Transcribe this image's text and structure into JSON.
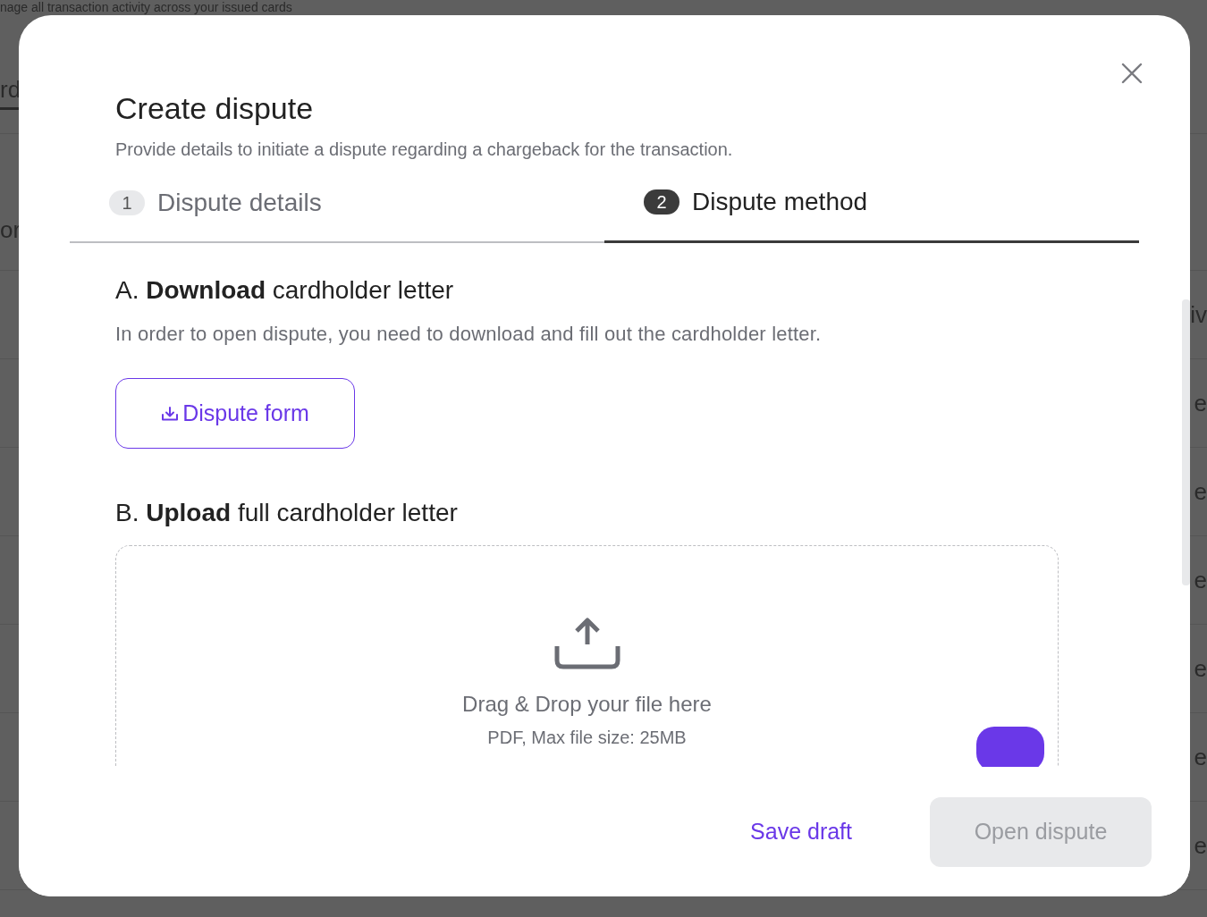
{
  "background_page": {
    "subtitle": "nage all transaction activity across your issued cards",
    "left_fragments": [
      "rd",
      "or"
    ],
    "right_fragments": [
      "iv",
      "e",
      "e",
      "e",
      "e",
      "e",
      "e"
    ]
  },
  "dialog": {
    "title": "Create dispute",
    "subtitle": "Provide details to initiate a dispute regarding a chargeback for the transaction.",
    "steps": [
      {
        "number": "1",
        "label": "Dispute details",
        "selected": false
      },
      {
        "number": "2",
        "label": "Dispute method",
        "selected": true
      }
    ],
    "sections": [
      {
        "kind": "download",
        "heading": "A. **Download** cardholder letter",
        "description": "In order to open dispute, you need to download and fill out the cardholder letter.",
        "button": "Dispute form"
      },
      {
        "kind": "upload",
        "heading": "B. **Upload** full cardholder letter",
        "dropzone": {
          "title": "Drag & Drop your file here",
          "hint": "PDF, Max file size: 25MB"
        }
      }
    ],
    "footer": {
      "secondary": "Save draft",
      "primary": {
        "label": "Open dispute",
        "disabled": true
      }
    }
  }
}
